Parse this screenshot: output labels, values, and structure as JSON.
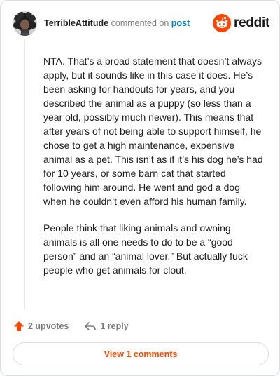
{
  "comment": {
    "author": "TerribleAttitude",
    "action_text": "commented on",
    "target_link": "post",
    "brand": "reddit",
    "paragraphs": [
      "NTA. That’s a broad statement that doesn’t always apply, but it sounds like in this case it does. He’s been asking for handouts for years, and you described the animal as a puppy (so less than a year old, possibly much newer). This means that after years of not being able to support himself, he chose to get a high maintenance, expensive animal as a pet. This isn’t as if it’s his dog he’s had for 10 years, or some barn cat that started following him around. He went and god a dog when he couldn’t even afford his human family.",
      "People think that liking animals and owning animals is all one needs to do to be a “good person” and an “animal lover.” But actually fuck people who get animals for clout."
    ]
  },
  "actions": {
    "upvotes": "2 upvotes",
    "reply": "1 reply",
    "view_comments": "View 1 comments"
  },
  "colors": {
    "accent": "#ff4500",
    "link": "#0079d3"
  },
  "icons": {
    "avatar": "curly-hair-avatar",
    "brand": "reddit-snoo-icon",
    "upvote": "upvote-arrow-icon",
    "reply": "reply-arrow-icon"
  }
}
